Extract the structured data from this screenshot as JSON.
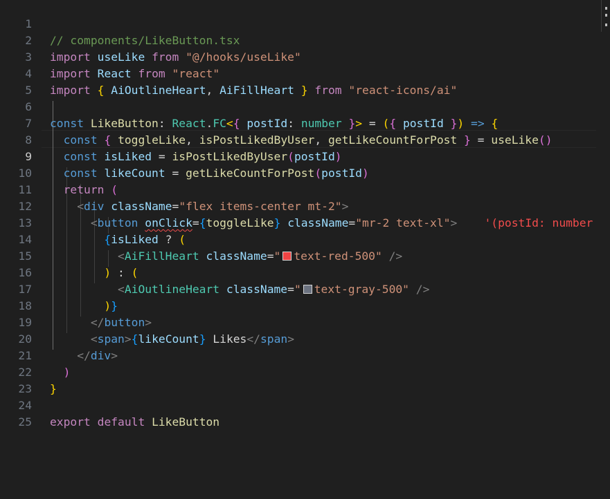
{
  "editor": {
    "file_comment": "// components/LikeButton.tsx",
    "active_line": 9,
    "colors": {
      "background": "#1f1f1f",
      "red_swatch": "#ef4444",
      "gray_swatch": "#6b7280"
    },
    "line_numbers": [
      "1",
      "2",
      "3",
      "4",
      "5",
      "6",
      "7",
      "8",
      "9",
      "10",
      "11",
      "12",
      "13",
      "14",
      "15",
      "16",
      "17",
      "18",
      "19",
      "20",
      "21",
      "22",
      "23",
      "24",
      "25"
    ],
    "tokens": {
      "l2": [
        "import",
        "useLike",
        "from",
        "\"@/hooks/useLike\""
      ],
      "l3": [
        "import",
        "React",
        "from",
        "\"react\""
      ],
      "l4": [
        "import",
        "{",
        "AiOutlineHeart",
        ",",
        "AiFillHeart",
        "}",
        "from",
        "\"react-icons/ai\""
      ],
      "l6": [
        "const",
        "LikeButton",
        ":",
        "React",
        ".",
        "FC",
        "<",
        "{",
        "postId",
        ":",
        "number",
        "}",
        ">",
        "=",
        "(",
        "{",
        "postId",
        "}",
        ")",
        "=>",
        "{"
      ],
      "l7": [
        "const",
        "{",
        "toggleLike",
        ",",
        "isPostLikedByUser",
        ",",
        "getLikeCountForPost",
        "}",
        "=",
        "useLike",
        "()"
      ],
      "l8": [
        "const",
        "isLiked",
        "=",
        "isPostLikedByUser",
        "(",
        "postId",
        ")"
      ],
      "l9": [
        "const",
        "likeCount",
        "=",
        "getLikeCountForPost",
        "(",
        "postId",
        ")"
      ],
      "l10": [
        "return",
        "("
      ],
      "l11": [
        "<",
        "div",
        "className",
        "=",
        "\"flex items-center mt-2\"",
        ">"
      ],
      "l12": [
        "<",
        "button",
        "onClick",
        "=",
        "{",
        "toggleLike",
        "}",
        "className",
        "=",
        "\"mr-2 text-xl\"",
        ">",
        "'(postId: number"
      ],
      "l13": [
        "{",
        "isLiked",
        "?",
        "("
      ],
      "l14": [
        "<",
        "AiFillHeart",
        "className",
        "=",
        "\"",
        "text-red-500\"",
        "/>"
      ],
      "l15": [
        ")",
        ":",
        "("
      ],
      "l16": [
        "<",
        "AiOutlineHeart",
        "className",
        "=",
        "\"",
        "text-gray-500\"",
        "/>"
      ],
      "l17": [
        ")",
        "}"
      ],
      "l18": [
        "</",
        "button",
        ">"
      ],
      "l19": [
        "<",
        "span",
        ">",
        "{",
        "likeCount",
        "}",
        " Likes",
        "</",
        "span",
        ">"
      ],
      "l20": [
        "</",
        "div",
        ">"
      ],
      "l21": [
        ")"
      ],
      "l22": [
        "}"
      ],
      "l24": [
        "export",
        "default",
        "LikeButton"
      ]
    }
  }
}
